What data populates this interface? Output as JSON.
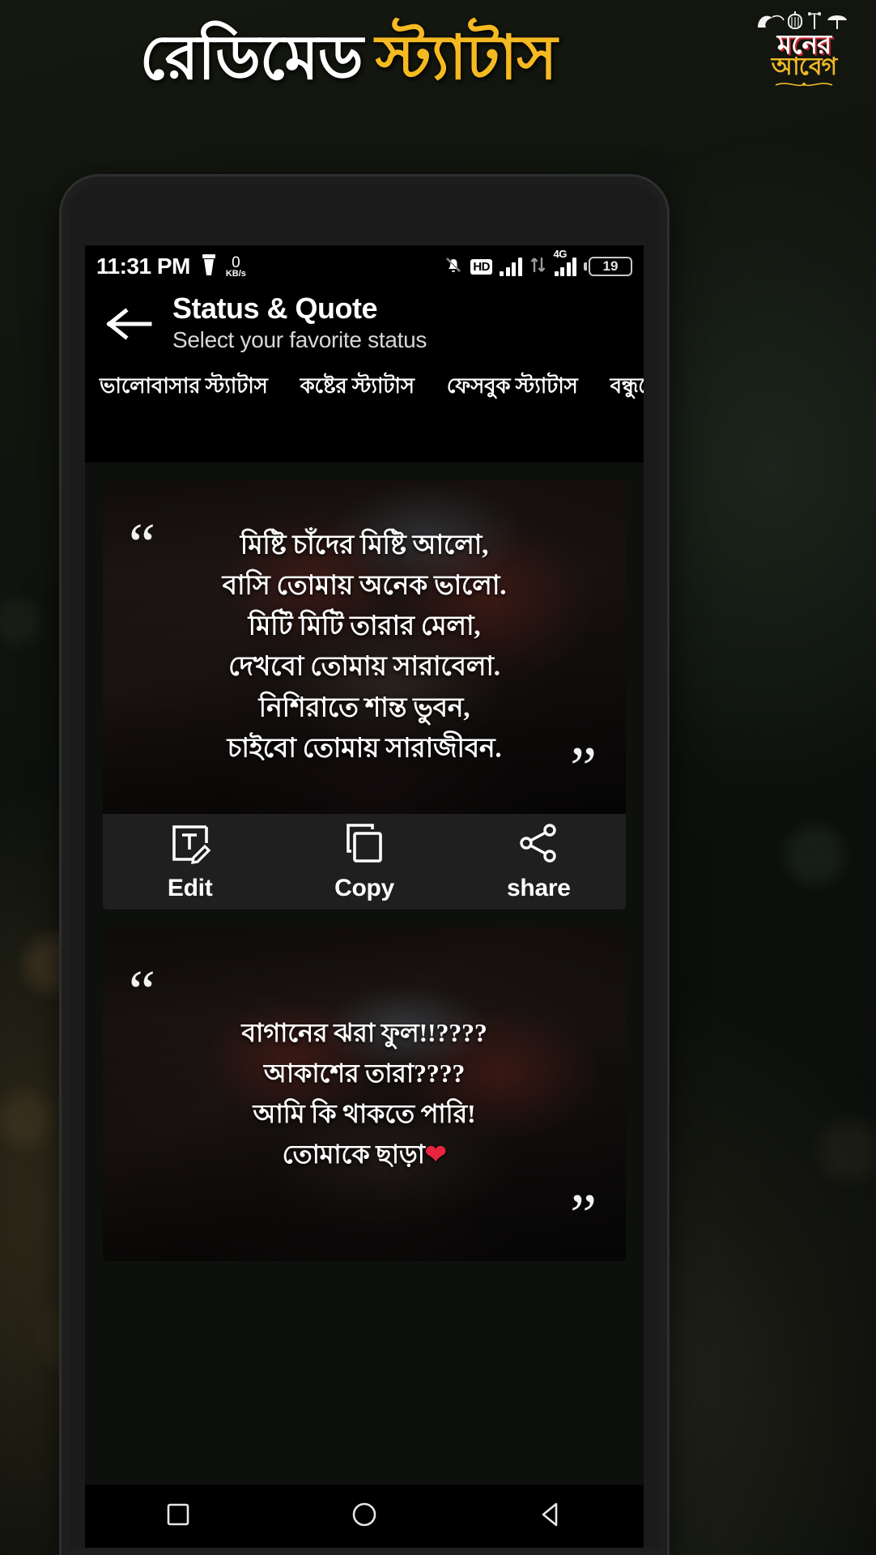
{
  "promo": {
    "title_word1": "রেডিমেড",
    "title_word2": "স্ট্যাটাস",
    "brand_line1": "মনের",
    "brand_line2": "আবেগ"
  },
  "status_bar": {
    "time": "11:31 PM",
    "flashlight_icon": "flashlight-icon",
    "data_rate_value": "0",
    "data_rate_unit": "KB/s",
    "mute_icon": "bell-muted-icon",
    "hd_label": "HD",
    "network_label": "4G",
    "battery_level": "19"
  },
  "app_bar": {
    "back_icon": "back-arrow-icon",
    "title": "Status & Quote",
    "subtitle": "Select your favorite status"
  },
  "tabs": [
    {
      "label": "ভালোবাসার স্ট্যাটাস"
    },
    {
      "label": "কষ্টের স্ট্যাটাস"
    },
    {
      "label": "ফেসবুক স্ট্যাটাস"
    },
    {
      "label": "বন্ধুত্বের স্ট্যাটাস"
    }
  ],
  "cards": [
    {
      "open_quote": "“",
      "close_quote": "”",
      "line1": "মিষ্টি চাঁদের মিষ্টি আলো,",
      "line2": "বাসি তোমায় অনেক ভালো.",
      "line3": "মিটি মিটি তারার মেলা,",
      "line4": "দেখবো তোমায় সারাবেলা.",
      "line5": "নিশিরাতে শান্ত ভুবন,",
      "line6": "চাইবো তোমায় সারাজীবন.",
      "edit_label": "Edit",
      "copy_label": "Copy",
      "share_label": "share"
    },
    {
      "open_quote": "“",
      "close_quote": "”",
      "line1": "বাগানের ঝরা ফুল!!????",
      "line2": "আকাশের তারা????",
      "line3": "আমি কি থাকতে পারি!",
      "line4": "তোমাকে ছাড়া",
      "heart": "❤"
    }
  ],
  "nav_bar": {
    "recents_icon": "square-icon",
    "home_icon": "circle-icon",
    "back_icon": "triangle-back-icon"
  },
  "colors": {
    "accent_yellow": "#f5b921",
    "brand_red": "#c9232b",
    "heart_red": "#e8253c"
  }
}
